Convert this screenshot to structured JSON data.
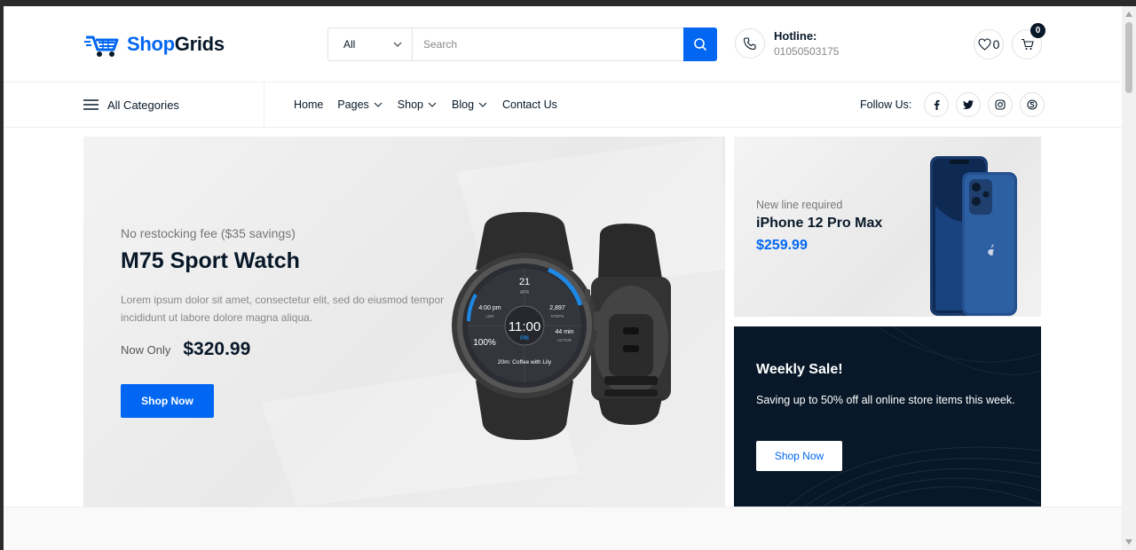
{
  "brand": {
    "name_part1": "Shop",
    "name_part2": "Grids",
    "accent": "#0167f3",
    "dark": "#081828"
  },
  "search": {
    "category_selected": "All",
    "placeholder": "Search",
    "value": ""
  },
  "hotline": {
    "title": "Hotline:",
    "number": "01050503175"
  },
  "wishlist": {
    "count": "0"
  },
  "cart": {
    "count": "0"
  },
  "nav": {
    "all_categories": "All Categories",
    "items": [
      {
        "label": "Home",
        "dropdown": false
      },
      {
        "label": "Pages",
        "dropdown": true
      },
      {
        "label": "Shop",
        "dropdown": true
      },
      {
        "label": "Blog",
        "dropdown": true
      },
      {
        "label": "Contact Us",
        "dropdown": false
      }
    ],
    "follow_label": "Follow Us:",
    "socials": [
      "facebook-icon",
      "twitter-icon",
      "instagram-icon",
      "skype-icon"
    ]
  },
  "hero": {
    "subtitle": "No restocking fee ($35 savings)",
    "title": "M75 Sport Watch",
    "description": "Lorem ipsum dolor sit amet, consectetur elit, sed do eiusmod tempor incididunt ut labore dolore magna aliqua.",
    "price_label": "Now Only",
    "price": "$320.99",
    "button": "Shop Now",
    "watch_face": {
      "date": "21",
      "month": "APR",
      "time_left": "4:00 pm",
      "time_left_sub": "LDN",
      "steps": "2,897",
      "steps_sub": "STEPS",
      "battery": "100%",
      "clock": "11:00",
      "day": "FRI",
      "active": "44 min",
      "active_sub": "ACTIVE",
      "event": "20m: Coffee with Lily"
    }
  },
  "promo_iphone": {
    "subtitle": "New line required",
    "title": "iPhone 12 Pro Max",
    "price": "$259.99"
  },
  "promo_sale": {
    "title": "Weekly Sale!",
    "description": "Saving up to 50% off all online store items this week.",
    "button": "Shop Now"
  }
}
